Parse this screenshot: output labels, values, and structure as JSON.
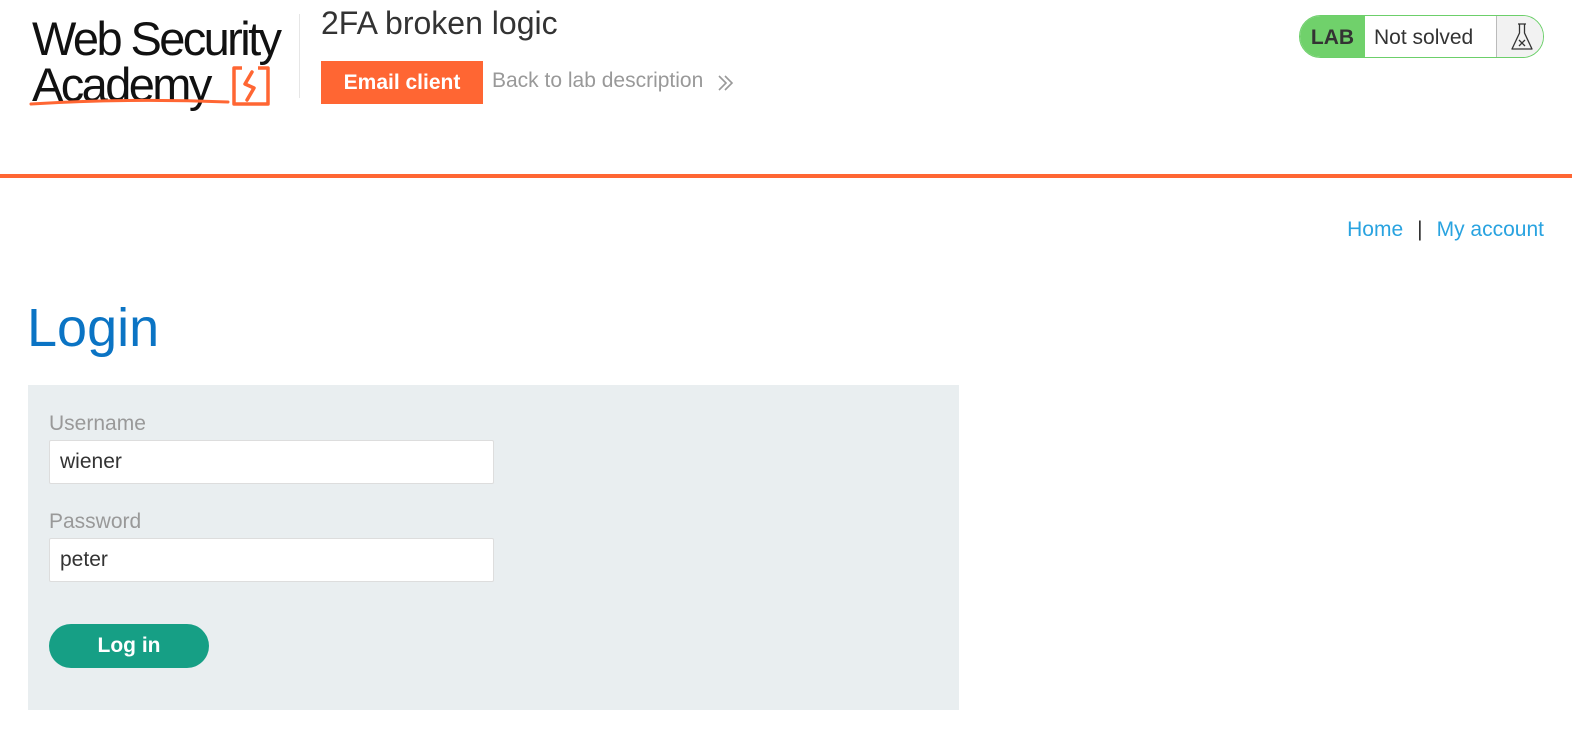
{
  "brand": {
    "line1": "Web Security",
    "line2": "Academy",
    "accent_color": "#ff6633"
  },
  "lab": {
    "title": "2FA broken logic",
    "email_client_label": "Email client",
    "back_link_label": "Back to lab description",
    "back_icon": "double-chevron-right-icon",
    "status_badge": "LAB",
    "status_text": "Not solved",
    "status_icon": "flask-icon",
    "status_color": "#70d16b"
  },
  "nav": {
    "home": "Home",
    "separator": "|",
    "my_account": "My account"
  },
  "page": {
    "title": "Login"
  },
  "form": {
    "username_label": "Username",
    "username_value": "wiener",
    "password_label": "Password",
    "password_value": "peter",
    "submit_label": "Log in",
    "submit_color": "#169f85"
  }
}
